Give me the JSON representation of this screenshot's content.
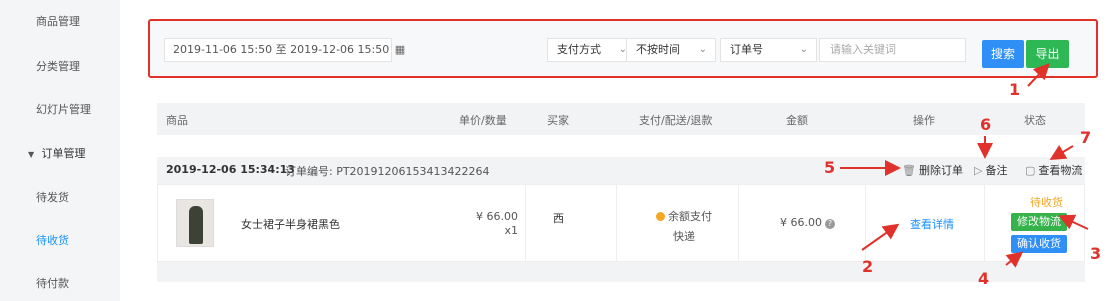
{
  "sidebar": {
    "items": [
      {
        "label": "商品管理"
      },
      {
        "label": "分类管理"
      },
      {
        "label": "幻灯片管理"
      },
      {
        "label": "订单管理"
      },
      {
        "label": "待发货"
      },
      {
        "label": "待收货"
      },
      {
        "label": "待付款"
      }
    ],
    "group_caret": "▼"
  },
  "filter": {
    "date_range": "2019-11-06 15:50 至 2019-12-06 15:50",
    "calendar_icon": "▦",
    "payment_select": "支付方式",
    "time_select": "不按时间",
    "field_select": "订单号",
    "keyword_placeholder": "请输入关键词",
    "chevron": "⌄"
  },
  "buttons": {
    "search": "搜索",
    "export": "导出"
  },
  "table": {
    "headers": [
      "商品",
      "单价/数量",
      "买家",
      "支付/配送/退款",
      "金额",
      "操作",
      "状态"
    ]
  },
  "order": {
    "time": "2019-12-06 15:34:13",
    "number": "订单编号: PT20191206153413422264",
    "ops": {
      "delete": "删除订单",
      "remark": "备注",
      "logistics": "查看物流",
      "delete_icon": "🗑",
      "remark_icon": "▷",
      "logistics_icon": "▢"
    },
    "product_name": "女士裙子半身裙黑色",
    "price": "¥ 66.00",
    "qty": "x1",
    "buyer": "西",
    "pay_method": "余额支付",
    "delivery": "快递",
    "amount": "¥ 66.00",
    "amount_help": "?",
    "detail": "查看详情",
    "status": "待收货",
    "modify_logistics": "修改物流",
    "confirm_receipt": "确认收货"
  },
  "annotations": [
    "1",
    "2",
    "3",
    "4",
    "5",
    "6",
    "7"
  ],
  "colors": {
    "accent_blue": "#2f8ff7",
    "accent_green": "#2eb755",
    "annotation_red": "#e0322b",
    "status_orange": "#f5a623"
  }
}
